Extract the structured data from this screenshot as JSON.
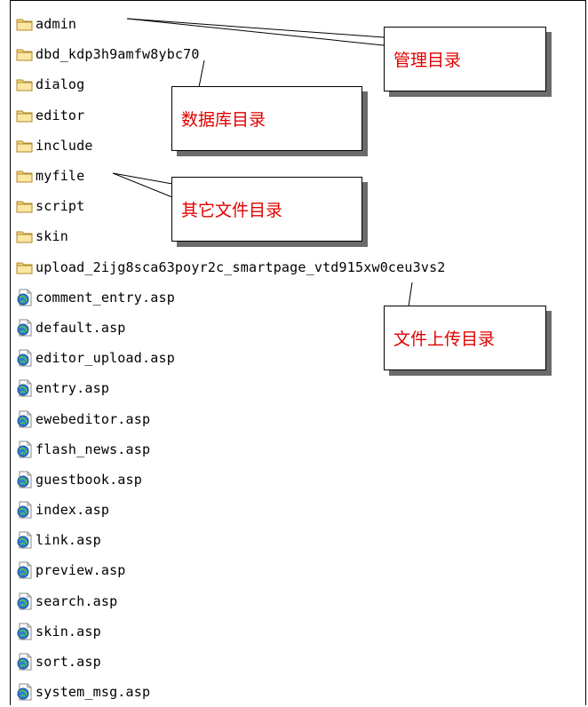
{
  "items": [
    {
      "name": "admin",
      "type": "folder"
    },
    {
      "name": "dbd_kdp3h9amfw8ybc70",
      "type": "folder"
    },
    {
      "name": "dialog",
      "type": "folder"
    },
    {
      "name": "editor",
      "type": "folder"
    },
    {
      "name": "include",
      "type": "folder"
    },
    {
      "name": "myfile",
      "type": "folder"
    },
    {
      "name": "script",
      "type": "folder"
    },
    {
      "name": "skin",
      "type": "folder"
    },
    {
      "name": "upload_2ijg8sca63poyr2c_smartpage_vtd915xw0ceu3vs2",
      "type": "folder"
    },
    {
      "name": "comment_entry.asp",
      "type": "asp"
    },
    {
      "name": "default.asp",
      "type": "asp"
    },
    {
      "name": "editor_upload.asp",
      "type": "asp"
    },
    {
      "name": "entry.asp",
      "type": "asp"
    },
    {
      "name": "ewebeditor.asp",
      "type": "asp"
    },
    {
      "name": "flash_news.asp",
      "type": "asp"
    },
    {
      "name": "guestbook.asp",
      "type": "asp"
    },
    {
      "name": "index.asp",
      "type": "asp"
    },
    {
      "name": "link.asp",
      "type": "asp"
    },
    {
      "name": "preview.asp",
      "type": "asp"
    },
    {
      "name": "search.asp",
      "type": "asp"
    },
    {
      "name": "skin.asp",
      "type": "asp"
    },
    {
      "name": "sort.asp",
      "type": "asp"
    },
    {
      "name": "system_msg.asp",
      "type": "asp"
    }
  ],
  "callouts": {
    "admin_dir": "管理目录",
    "database_dir": "数据库目录",
    "other_files_dir": "其它文件目录",
    "upload_dir": "文件上传目录"
  },
  "colors": {
    "callout_text": "#e00000",
    "folder_fill": "#f6d77a",
    "folder_stroke": "#b08a2a"
  }
}
